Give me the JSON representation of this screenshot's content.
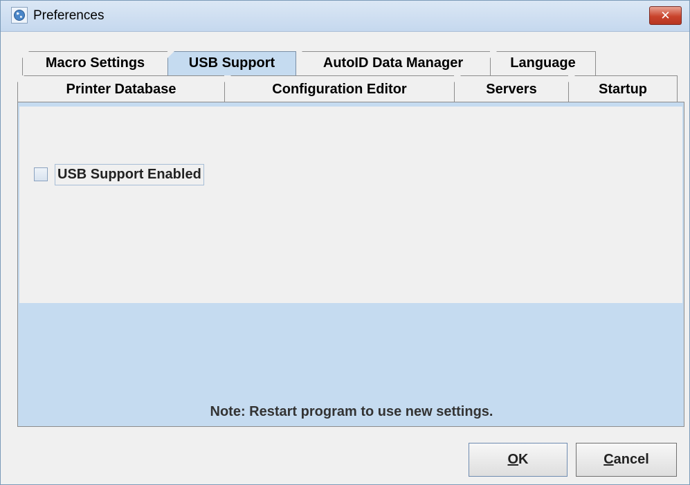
{
  "window": {
    "title": "Preferences",
    "close_label": "✕",
    "icon": "app-globe-icon"
  },
  "tabs": {
    "row1": [
      {
        "label": "Macro Settings",
        "selected": false
      },
      {
        "label": "USB Support",
        "selected": true
      },
      {
        "label": "AutoID Data Manager",
        "selected": false
      },
      {
        "label": "Language",
        "selected": false
      }
    ],
    "row2": [
      {
        "label": "Printer Database",
        "selected": false
      },
      {
        "label": "Configuration Editor",
        "selected": false
      },
      {
        "label": "Servers",
        "selected": false
      },
      {
        "label": "Startup",
        "selected": false
      }
    ]
  },
  "usb": {
    "checkbox_label": "USB Support Enabled",
    "checked": false
  },
  "note": "Note: Restart program to use new settings.",
  "buttons": {
    "ok_mnemonic": "O",
    "ok_rest": "K",
    "cancel_mnemonic": "C",
    "cancel_rest": "ancel"
  },
  "colors": {
    "selected_tab": "#c5dbf0",
    "panel_bg": "#c5dbf0",
    "close_button": "#c9432c"
  }
}
